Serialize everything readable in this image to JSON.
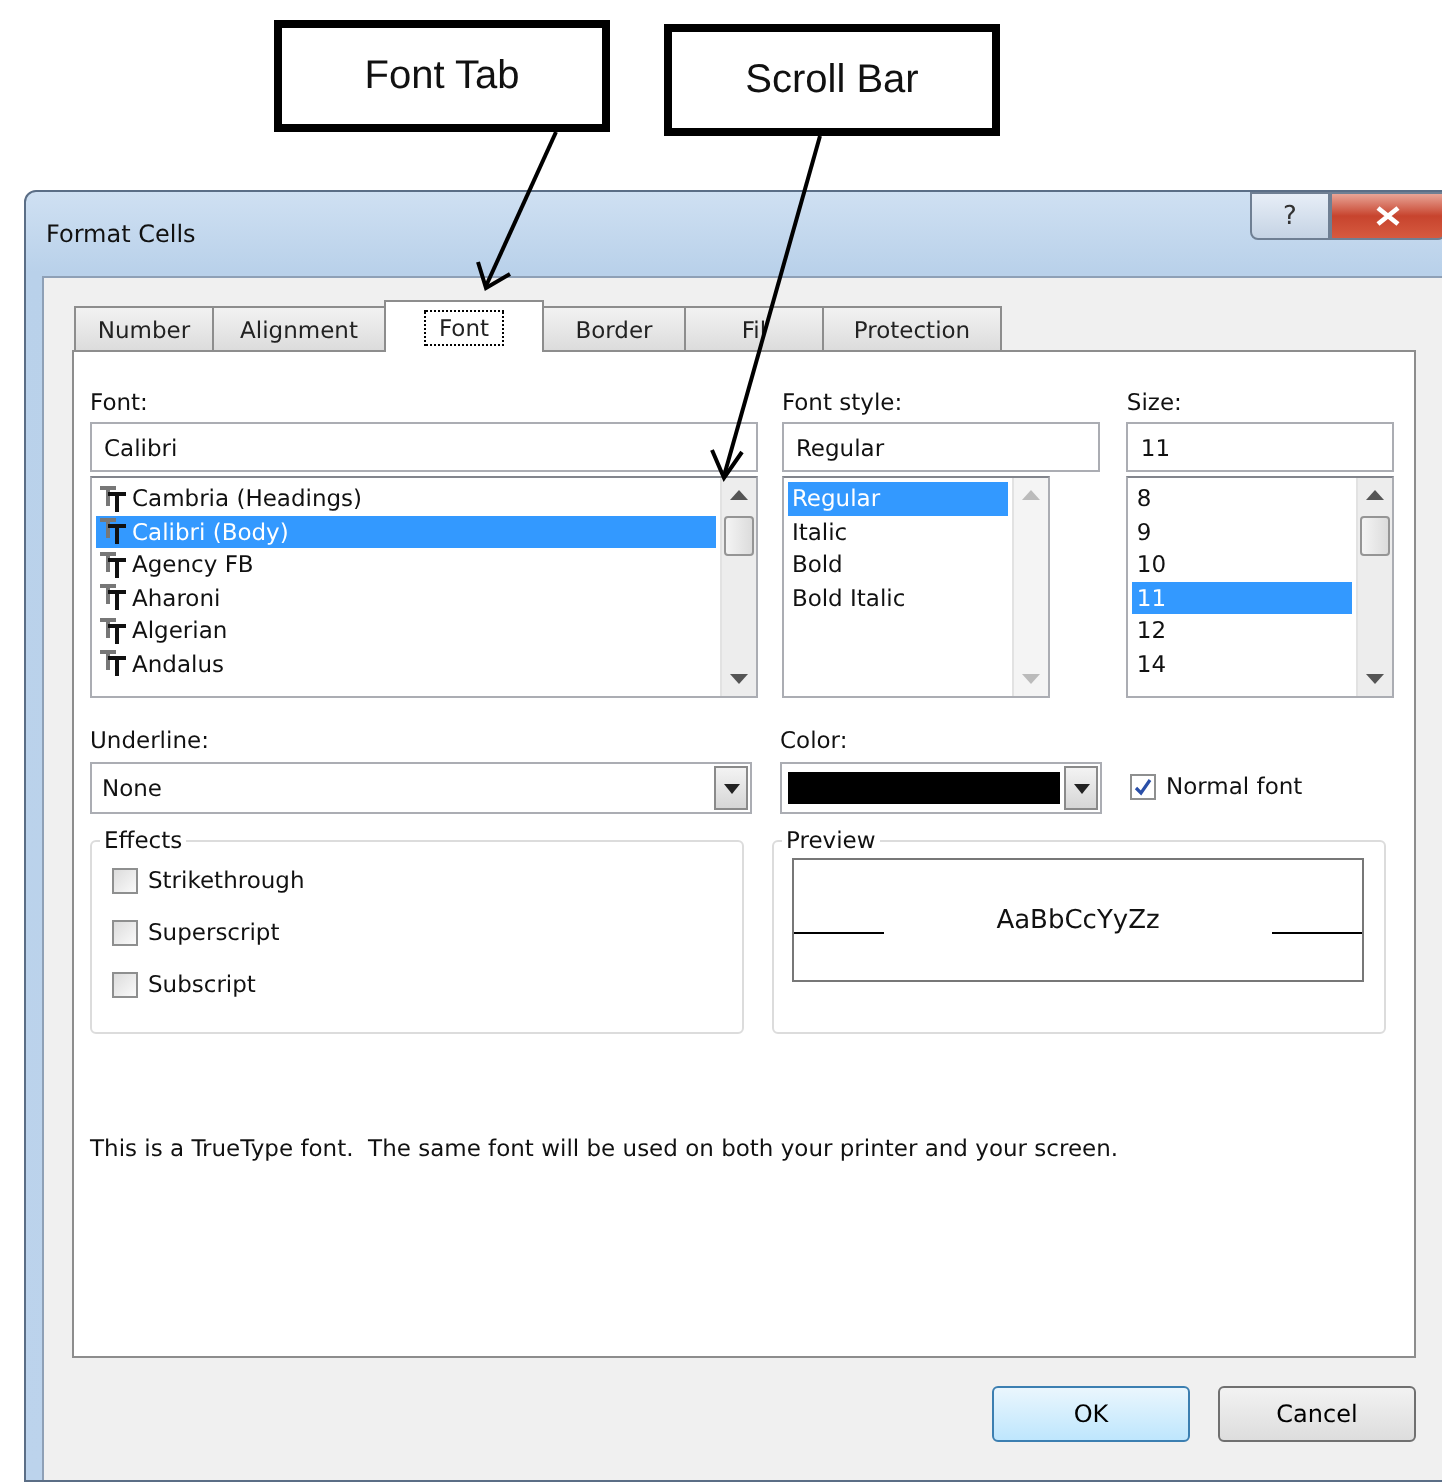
{
  "annotations": [
    {
      "text": "Font Tab"
    },
    {
      "text": "Scroll Bar"
    }
  ],
  "window": {
    "title": "Format Cells",
    "help_button": "?"
  },
  "tabs": [
    {
      "label": "Number",
      "selected": false
    },
    {
      "label": "Alignment",
      "selected": false
    },
    {
      "label": "Font",
      "selected": true
    },
    {
      "label": "Border",
      "selected": false
    },
    {
      "label": "Fil",
      "selected": false
    },
    {
      "label": "Protection",
      "selected": false
    }
  ],
  "font": {
    "label": "Font:",
    "value": "Calibri",
    "items": [
      {
        "label": "Cambria (Headings)",
        "selected": false
      },
      {
        "label": "Calibri (Body)",
        "selected": true
      },
      {
        "label": "Agency FB",
        "selected": false
      },
      {
        "label": "Aharoni",
        "selected": false
      },
      {
        "label": "Algerian",
        "selected": false
      },
      {
        "label": "Andalus",
        "selected": false
      }
    ]
  },
  "font_style": {
    "label": "Font style:",
    "value": "Regular",
    "items": [
      {
        "label": "Regular",
        "selected": true
      },
      {
        "label": "Italic",
        "selected": false
      },
      {
        "label": "Bold",
        "selected": false
      },
      {
        "label": "Bold Italic",
        "selected": false
      }
    ]
  },
  "size": {
    "label": "Size:",
    "value": "11",
    "items": [
      {
        "label": "8",
        "selected": false
      },
      {
        "label": "9",
        "selected": false
      },
      {
        "label": "10",
        "selected": false
      },
      {
        "label": "11",
        "selected": true
      },
      {
        "label": "12",
        "selected": false
      },
      {
        "label": "14",
        "selected": false
      }
    ]
  },
  "underline": {
    "label": "Underline:",
    "value": "None"
  },
  "color": {
    "label": "Color:"
  },
  "normal_font": {
    "label": "Normal font",
    "checked": true
  },
  "effects": {
    "title": "Effects",
    "options": [
      {
        "label": "Strikethrough",
        "checked": false
      },
      {
        "label": "Superscript",
        "checked": false
      },
      {
        "label": "Subscript",
        "checked": false
      }
    ]
  },
  "preview": {
    "title": "Preview",
    "sample": "AaBbCcYyZz"
  },
  "description": "This is a TrueType font.  The same font will be used on both your printer and your screen.",
  "buttons": [
    {
      "label": "OK",
      "default": true
    },
    {
      "label": "Cancel",
      "default": false
    }
  ]
}
